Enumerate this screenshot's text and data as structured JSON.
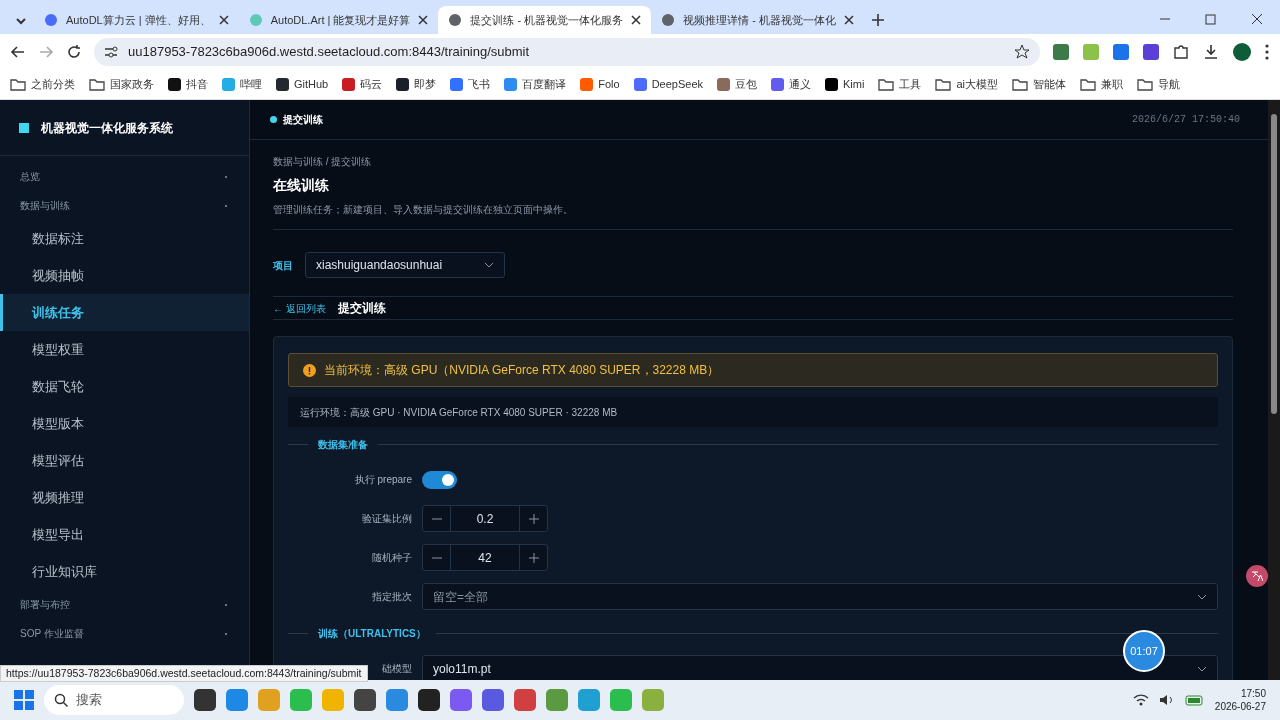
{
  "browser": {
    "tabs": [
      {
        "title": "AutoDL算力云 | 弹性、好用、",
        "selected": false,
        "color": "#4a6cf7"
      },
      {
        "title": "AutoDL.Art | 能复现才是好算",
        "selected": false,
        "color": "#5fc9b8"
      },
      {
        "title": "提交训练 - 机器视觉一体化服务",
        "selected": true,
        "color": "#5f6368"
      },
      {
        "title": "视频推理详情 - 机器视觉一体化",
        "selected": false,
        "color": "#5f6368"
      }
    ],
    "url": "uu187953-7823c6ba906d.westd.seetacloud.com:8443/training/submit",
    "bookmarks": [
      {
        "label": "之前分类",
        "kind": "folder"
      },
      {
        "label": "国家政务",
        "kind": "folder"
      },
      {
        "label": "抖音",
        "kind": "site",
        "color": "#111111"
      },
      {
        "label": "哔哩",
        "kind": "site",
        "color": "#23ade5"
      },
      {
        "label": "GitHub",
        "kind": "site",
        "color": "#24292f"
      },
      {
        "label": "码云",
        "kind": "site",
        "color": "#c71d23"
      },
      {
        "label": "即梦",
        "kind": "site",
        "color": "#1b1f2a"
      },
      {
        "label": "飞书",
        "kind": "site",
        "color": "#3370ff"
      },
      {
        "label": "百度翻译",
        "kind": "site",
        "color": "#2e8cf0"
      },
      {
        "label": "Folo",
        "kind": "site",
        "color": "#ff5c00"
      },
      {
        "label": "DeepSeek",
        "kind": "site",
        "color": "#4d6bfe"
      },
      {
        "label": "豆包",
        "kind": "site",
        "color": "#8a6a5a"
      },
      {
        "label": "通义",
        "kind": "site",
        "color": "#615ced"
      },
      {
        "label": "Kimi",
        "kind": "site",
        "color": "#000000"
      },
      {
        "label": "工具",
        "kind": "folder"
      },
      {
        "label": "ai大模型",
        "kind": "folder"
      },
      {
        "label": "智能体",
        "kind": "folder"
      },
      {
        "label": "兼职",
        "kind": "folder"
      },
      {
        "label": "导航",
        "kind": "folder"
      }
    ],
    "status_url": "https://uu187953-7823c6ba906d.westd.seetacloud.com:8443/training/submit"
  },
  "app": {
    "brand": "机器视觉一体化服务系统",
    "sidebar": [
      {
        "label": "总览"
      },
      {
        "label": "数据与训练",
        "children": [
          {
            "label": "数据标注",
            "selected": false
          },
          {
            "label": "视频抽帧",
            "selected": false
          },
          {
            "label": "训练任务",
            "selected": true
          },
          {
            "label": "模型权重",
            "selected": false
          },
          {
            "label": "数据飞轮",
            "selected": false
          },
          {
            "label": "模型版本",
            "selected": false
          },
          {
            "label": "模型评估",
            "selected": false
          },
          {
            "label": "视频推理",
            "selected": false
          },
          {
            "label": "模型导出",
            "selected": false
          },
          {
            "label": "行业知识库",
            "selected": false
          }
        ]
      },
      {
        "label": "部署与布控"
      },
      {
        "label": "SOP 作业监督"
      }
    ],
    "topbar": {
      "title": "提交训练",
      "datetime": "2026/6/27 17:50:40"
    },
    "page": {
      "breadcrumb": "数据与训练 / 提交训练",
      "title": "在线训练",
      "subtitle": "管理训练任务；新建项目、导入数据与提交训练在独立页面中操作。",
      "project_label": "项目",
      "project_value": "xiashuiguandaosunhuai",
      "back_link": "← 返回列表",
      "tab_title": "提交训练",
      "alert": "当前环境：高级 GPU（NVIDIA GeForce RTX 4080 SUPER，32228 MB）",
      "env_info": "运行环境：高级 GPU · NVIDIA GeForce RTX 4080 SUPER · 32228 MB",
      "sections": [
        {
          "title": "数据集准备",
          "fields": [
            {
              "kind": "switch",
              "label": "执行 prepare",
              "on": true
            },
            {
              "kind": "stepper",
              "label": "验证集比例",
              "value": "0.2"
            },
            {
              "kind": "stepper",
              "label": "随机种子",
              "value": "42"
            },
            {
              "kind": "select",
              "label": "指定批次",
              "placeholder": "留空=全部"
            }
          ]
        },
        {
          "title": "训练（ULTRALYTICS）",
          "fields": [
            {
              "kind": "select",
              "label": "础模型",
              "value": "yolo11m.pt"
            }
          ]
        }
      ]
    },
    "timer": "01:07"
  },
  "taskbar": {
    "search_placeholder": "搜索",
    "time": "17:50",
    "date": "2026-06-27"
  }
}
